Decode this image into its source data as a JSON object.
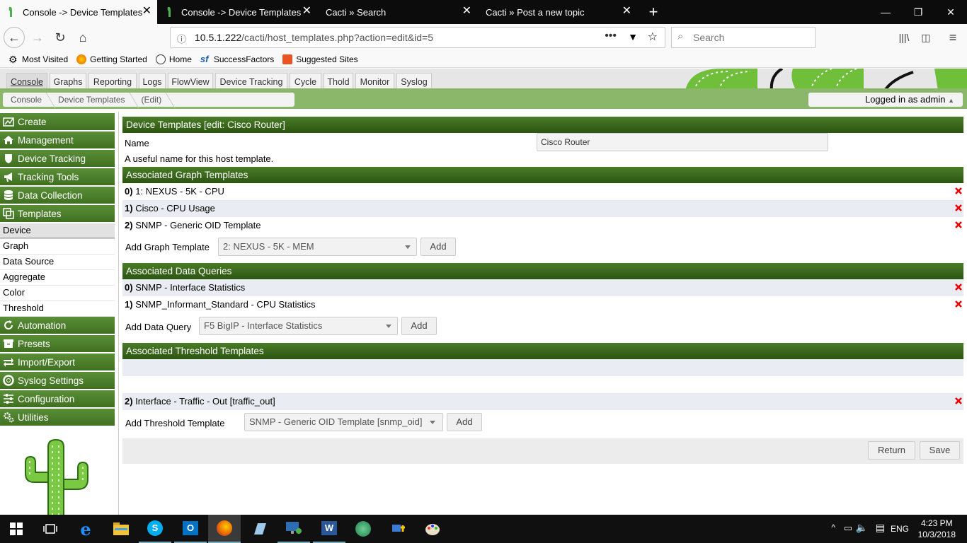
{
  "browser": {
    "tabs": [
      {
        "title": "Console -> Device Templates -",
        "active": true
      },
      {
        "title": "Console -> Device Templates",
        "active": false
      },
      {
        "title": "Cacti » Search",
        "active": false
      },
      {
        "title": "Cacti » Post a new topic",
        "active": false
      }
    ],
    "url_prefix": "10.5.1.222",
    "url_path": "/cacti/host_templates.php?action=edit&id=5",
    "search_placeholder": "Search",
    "bookmarks": [
      "Most Visited",
      "Getting Started",
      "Home",
      "SuccessFactors",
      "Suggested Sites"
    ]
  },
  "cacti_tabs": [
    "Console",
    "Graphs",
    "Reporting",
    "Logs",
    "FlowView",
    "Device Tracking",
    "Cycle",
    "Thold",
    "Monitor",
    "Syslog"
  ],
  "breadcrumb": [
    "Console",
    "Device Templates",
    "(Edit)"
  ],
  "logged_in": "Logged in as admin",
  "sidebar": {
    "sections": [
      {
        "label": "Create",
        "icon": "chart-icon"
      },
      {
        "label": "Management",
        "icon": "home-icon"
      },
      {
        "label": "Device Tracking",
        "icon": "shield-icon"
      },
      {
        "label": "Tracking Tools",
        "icon": "megaphone-icon"
      },
      {
        "label": "Data Collection",
        "icon": "database-icon"
      },
      {
        "label": "Templates",
        "icon": "copy-icon"
      },
      {
        "label": "Automation",
        "icon": "refresh-icon"
      },
      {
        "label": "Presets",
        "icon": "archive-icon"
      },
      {
        "label": "Import/Export",
        "icon": "exchange-icon"
      },
      {
        "label": "Syslog Settings",
        "icon": "lifebuoy-icon"
      },
      {
        "label": "Configuration",
        "icon": "sliders-icon"
      },
      {
        "label": "Utilities",
        "icon": "gears-icon"
      }
    ],
    "template_items": [
      "Device",
      "Graph",
      "Data Source",
      "Aggregate",
      "Color",
      "Threshold"
    ]
  },
  "main": {
    "title": "Device Templates [edit: Cisco Router]",
    "name_label": "Name",
    "name_value": "Cisco Router",
    "name_help": "A useful name for this host template.",
    "graph_templates_header": "Associated Graph Templates",
    "graph_templates": [
      {
        "idx": "0)",
        "name": "1: NEXUS - 5K - CPU"
      },
      {
        "idx": "1)",
        "name": "Cisco - CPU Usage"
      },
      {
        "idx": "2)",
        "name": "SNMP - Generic OID Template"
      }
    ],
    "add_graph_label": "Add Graph Template",
    "add_graph_selected": "2: NEXUS - 5K - MEM",
    "data_queries_header": "Associated Data Queries",
    "data_queries": [
      {
        "idx": "0)",
        "name": "SNMP - Interface Statistics"
      },
      {
        "idx": "1)",
        "name": "SNMP_Informant_Standard - CPU Statistics"
      }
    ],
    "add_query_label": "Add Data Query",
    "add_query_selected": "F5 BigIP - Interface Statistics",
    "threshold_header": "Associated Threshold Templates",
    "threshold_templates": [
      {
        "idx": "2)",
        "name": "Interface - Traffic - Out [traffic_out]"
      }
    ],
    "add_threshold_label": "Add Threshold Template",
    "add_threshold_selected": "SNMP - Generic OID Template [snmp_oid]",
    "add_label": "Add",
    "return_label": "Return",
    "save_label": "Save"
  },
  "taskbar": {
    "clock_time": "4:23 PM",
    "clock_date": "10/3/2018",
    "lang": "ENG"
  }
}
